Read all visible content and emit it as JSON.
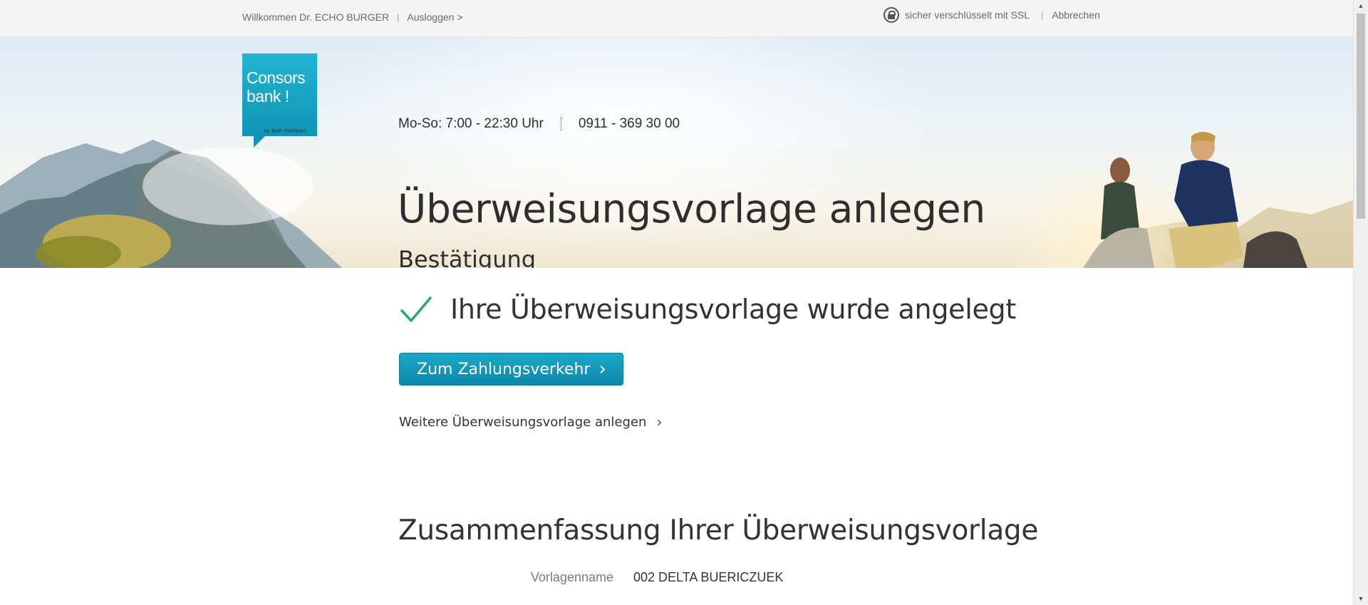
{
  "topbar": {
    "welcome": "Willkommen Dr. ECHO BURGER",
    "logout": "Ausloggen >",
    "ssl_text": "sicher verschlüsselt mit SSL",
    "cancel": "Abbrechen"
  },
  "brand": {
    "name_line1": "Consors",
    "name_line2": "bank !",
    "sub": "by BNP PARIBAS",
    "colors": {
      "brand_teal": "#1aa8c8",
      "success_green": "#2aa37a"
    }
  },
  "header": {
    "hours": "Mo-So: 7:00 - 22:30 Uhr",
    "phone": "0911 - 369 30 00",
    "title": "Überweisungsvorlage anlegen",
    "subtitle": "Bestätigung"
  },
  "confirmation": {
    "icon": "checkmark-icon",
    "message": "Ihre Überweisungsvorlage wurde angelegt",
    "primary_button": "Zum Zahlungsverkehr",
    "secondary_link": "Weitere Überweisungsvorlage anlegen"
  },
  "summary": {
    "title": "Zusammenfassung Ihrer Überweisungsvorlage",
    "rows": [
      {
        "label": "Vorlagenname",
        "value": "002 DELTA BUERICZUEK"
      }
    ]
  }
}
